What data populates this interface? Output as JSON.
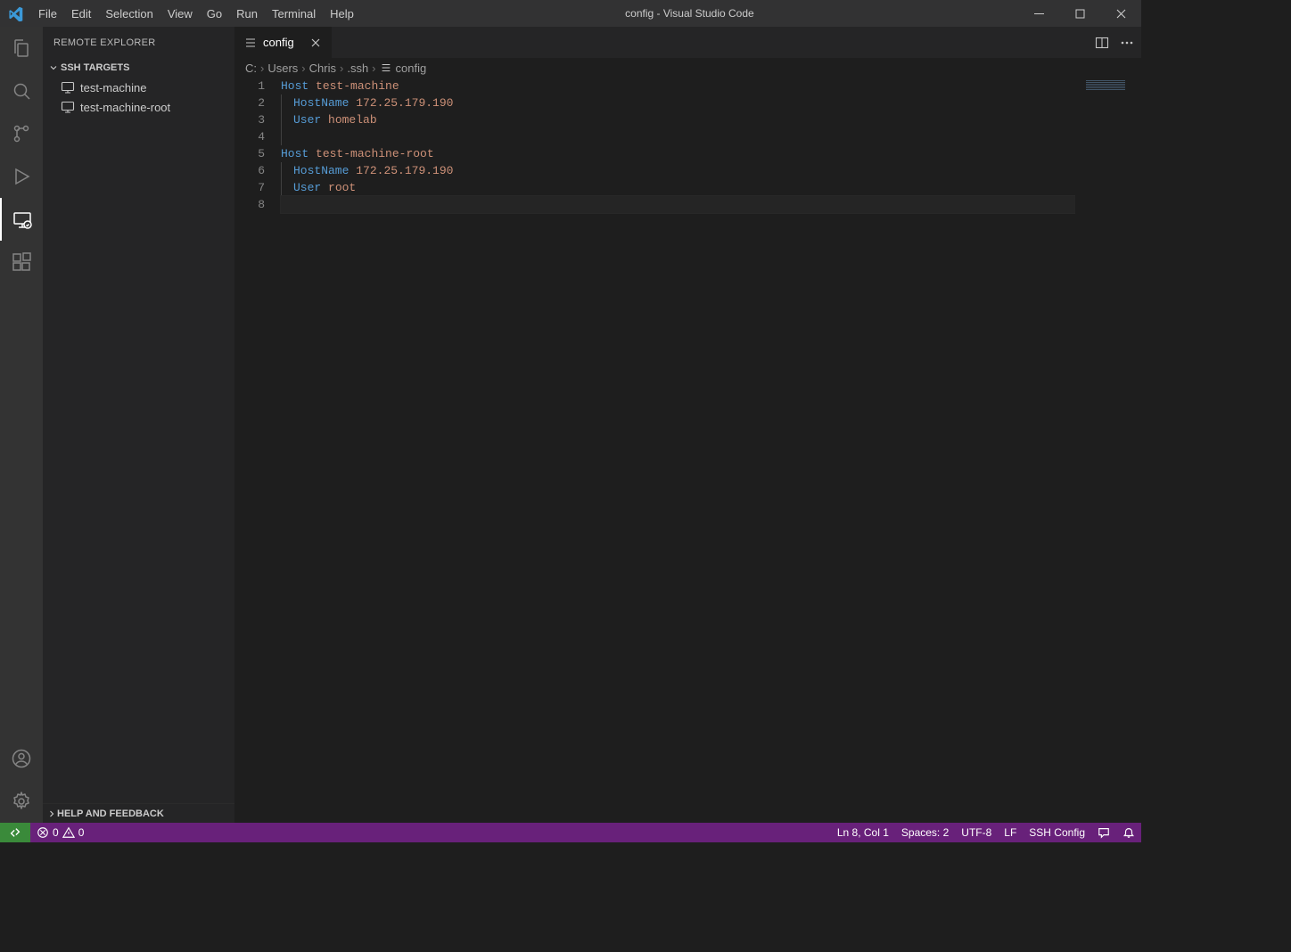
{
  "window": {
    "title": "config - Visual Studio Code"
  },
  "menu": {
    "file": "File",
    "edit": "Edit",
    "selection": "Selection",
    "view": "View",
    "go": "Go",
    "run": "Run",
    "terminal": "Terminal",
    "help": "Help"
  },
  "sidebar": {
    "title": "REMOTE EXPLORER",
    "section_ssh": "SSH TARGETS",
    "targets": [
      {
        "label": "test-machine"
      },
      {
        "label": "test-machine-root"
      }
    ],
    "help_section": "HELP AND FEEDBACK"
  },
  "tab": {
    "label": "config"
  },
  "breadcrumbs": {
    "parts": [
      "C:",
      "Users",
      "Chris",
      ".ssh",
      "config"
    ]
  },
  "editor": {
    "lines": [
      {
        "n": "1",
        "indent": 0,
        "tokens": [
          [
            "key",
            "Host"
          ],
          [
            "plain",
            " "
          ],
          [
            "str",
            "test-machine"
          ]
        ]
      },
      {
        "n": "2",
        "indent": 1,
        "tokens": [
          [
            "key",
            "HostName"
          ],
          [
            "plain",
            " "
          ],
          [
            "str",
            "172.25.179.190"
          ]
        ]
      },
      {
        "n": "3",
        "indent": 1,
        "tokens": [
          [
            "key",
            "User"
          ],
          [
            "plain",
            " "
          ],
          [
            "str",
            "homelab"
          ]
        ]
      },
      {
        "n": "4",
        "indent": 1,
        "tokens": []
      },
      {
        "n": "5",
        "indent": 0,
        "tokens": [
          [
            "key",
            "Host"
          ],
          [
            "plain",
            " "
          ],
          [
            "str",
            "test-machine-root"
          ]
        ]
      },
      {
        "n": "6",
        "indent": 1,
        "tokens": [
          [
            "key",
            "HostName"
          ],
          [
            "plain",
            " "
          ],
          [
            "str",
            "172.25.179.190"
          ]
        ]
      },
      {
        "n": "7",
        "indent": 1,
        "tokens": [
          [
            "key",
            "User"
          ],
          [
            "plain",
            " "
          ],
          [
            "str",
            "root"
          ]
        ]
      },
      {
        "n": "8",
        "indent": 0,
        "tokens": [],
        "current": true
      }
    ]
  },
  "status": {
    "errors": "0",
    "warnings": "0",
    "cursor": "Ln 8, Col 1",
    "spaces": "Spaces: 2",
    "encoding": "UTF-8",
    "eol": "LF",
    "language": "SSH Config"
  }
}
